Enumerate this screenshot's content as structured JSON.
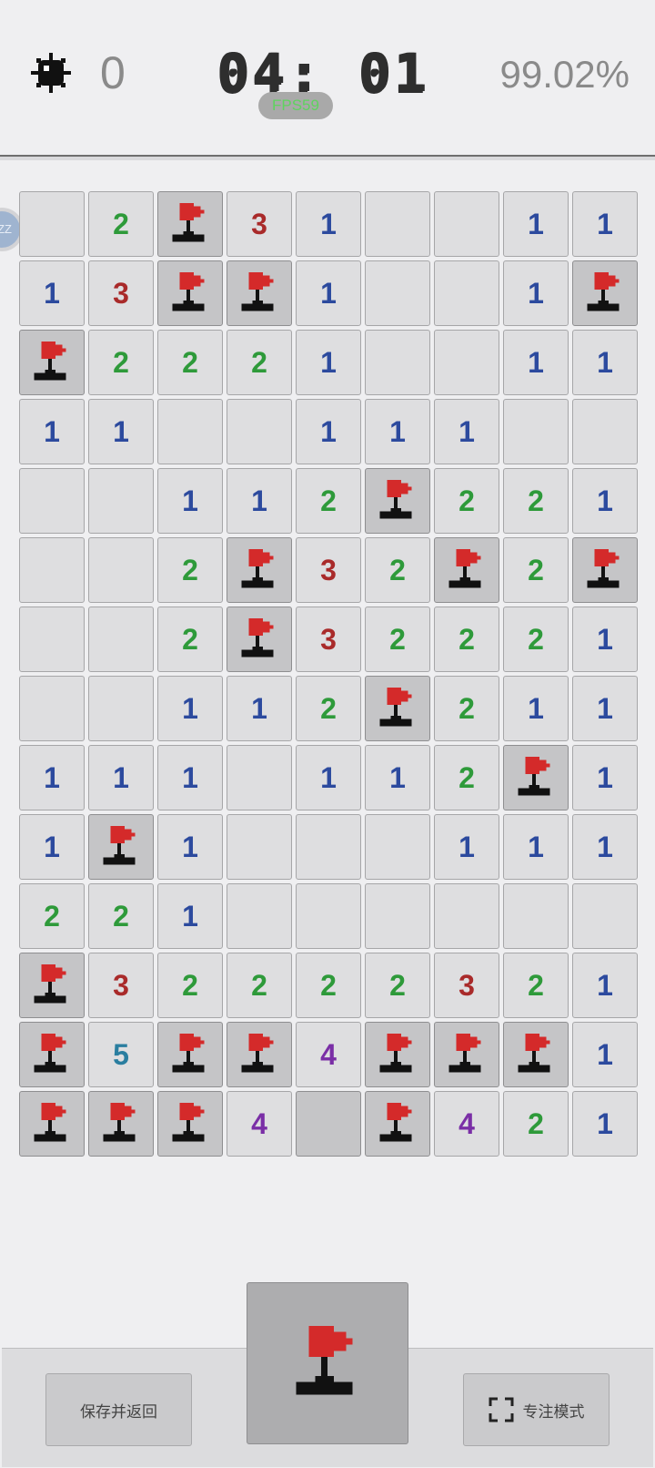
{
  "header": {
    "mines_remaining": "0",
    "timer": "04: 01",
    "fps": "FPS59",
    "progress": "99.02%",
    "side_bubble": "ZZ"
  },
  "colors": {
    "flag": "#d42a2a",
    "n1": "#2c4a9e",
    "n2": "#2e9a3a",
    "n3": "#a92a2a",
    "n4": "#7a2ea6",
    "n5": "#2a7ea0"
  },
  "board": {
    "cols": 9,
    "rows": [
      [
        "",
        "2",
        "F",
        "3",
        "1",
        "",
        "",
        "1",
        "1"
      ],
      [
        "1",
        "3",
        "F",
        "F",
        "1",
        "",
        "",
        "1",
        "F"
      ],
      [
        "F",
        "2",
        "2",
        "2",
        "1",
        "",
        "",
        "1",
        "1"
      ],
      [
        "1",
        "1",
        "",
        "",
        "1",
        "1",
        "1",
        "",
        ""
      ],
      [
        "",
        "",
        "1",
        "1",
        "2",
        "F",
        "2",
        "2",
        "1"
      ],
      [
        "",
        "",
        "2",
        "F",
        "3",
        "2",
        "F",
        "2",
        "F"
      ],
      [
        "",
        "",
        "2",
        "F",
        "3",
        "2",
        "2",
        "2",
        "1"
      ],
      [
        "",
        "",
        "1",
        "1",
        "2",
        "F",
        "2",
        "1",
        "1"
      ],
      [
        "1",
        "1",
        "1",
        "",
        "1",
        "1",
        "2",
        "F",
        "1"
      ],
      [
        "1",
        "F",
        "1",
        "",
        "",
        "",
        "1",
        "1",
        "1"
      ],
      [
        "2",
        "2",
        "1",
        "",
        "",
        "",
        "",
        "",
        ""
      ],
      [
        "F",
        "3",
        "2",
        "2",
        "2",
        "2",
        "3",
        "2",
        "1"
      ],
      [
        "F",
        "5",
        "F",
        "F",
        "4",
        "F",
        "F",
        "F",
        "1"
      ],
      [
        "F",
        "F",
        "F",
        "4",
        "C",
        "F",
        "4",
        "2",
        "1"
      ]
    ]
  },
  "footer": {
    "save_label": "保存并返回",
    "focus_label": "专注模式",
    "mode_icon": "flag-icon",
    "focus_icon": "fullscreen-icon"
  }
}
